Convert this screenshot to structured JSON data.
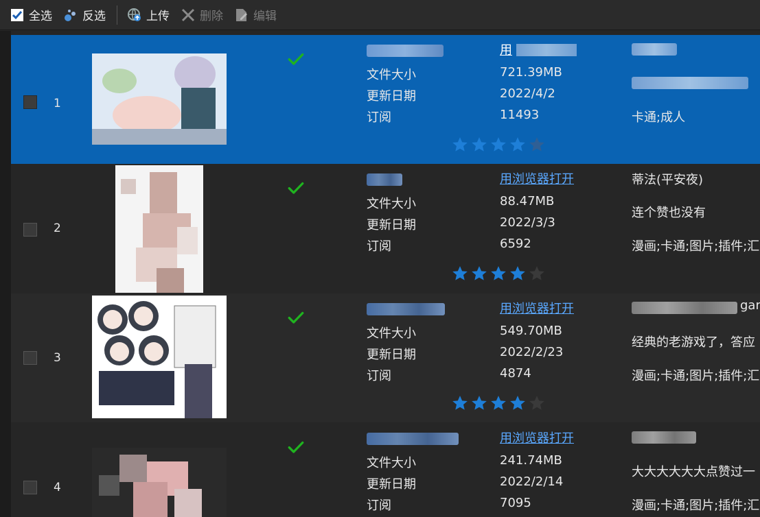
{
  "toolbar": {
    "select_all": "全选",
    "invert": "反选",
    "upload": "上传",
    "delete": "删除",
    "edit": "编辑"
  },
  "labels": {
    "size": "文件大小",
    "date": "更新日期",
    "subs": "订阅",
    "open_browser": "用浏览器打开"
  },
  "colors": {
    "selected": "#0a63b3",
    "star": "#1e7fd8",
    "check": "#1fb31f"
  },
  "rows": [
    {
      "index": "1",
      "size": "721.39MB",
      "date": "2022/4/2",
      "subs": "11493",
      "rating": 4,
      "tags": "卡通;成人",
      "selected": true
    },
    {
      "index": "2",
      "size": "88.47MB",
      "date": "2022/3/3",
      "subs": "6592",
      "rating": 4,
      "title2": "蒂法(平安夜)",
      "desc": "连个赞也没有",
      "tags": "漫画;卡通;图片;插件;汇"
    },
    {
      "index": "3",
      "size": "549.70MB",
      "date": "2022/2/23",
      "subs": "4874",
      "rating": 4,
      "title_tail": "gar",
      "desc": "经典的老游戏了，答应",
      "tags": "漫画;卡通;图片;插件;汇"
    },
    {
      "index": "4",
      "size": "241.74MB",
      "date": "2022/2/14",
      "subs": "7095",
      "rating": 4,
      "desc": "大大大大大大点赞过一",
      "tags": "漫画;卡通;图片;插件;汇"
    }
  ]
}
